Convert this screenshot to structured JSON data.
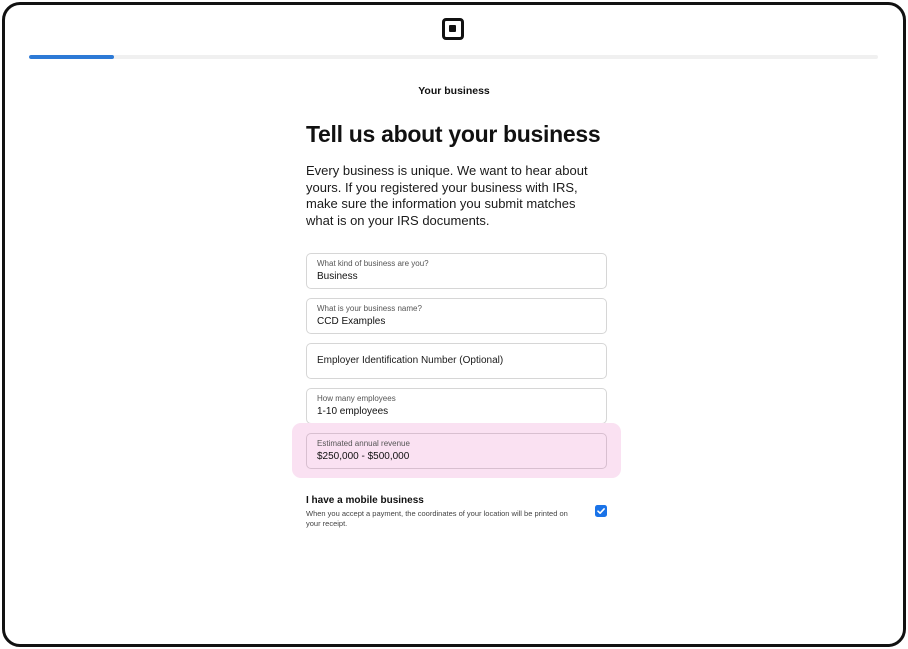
{
  "brand": {
    "logo_icon": "square-logo-icon"
  },
  "progress": {
    "fraction": 0.1
  },
  "step_label": "Your business",
  "page": {
    "title": "Tell us about your business",
    "intro": "Every business is unique. We want to hear about yours. If you registered your business with IRS, make sure the information you submit matches what is on your IRS documents."
  },
  "fields": {
    "business_type": {
      "label": "What kind of business are you?",
      "value": "Business"
    },
    "business_name": {
      "label": "What is your business name?",
      "value": "CCD Examples"
    },
    "ein": {
      "placeholder": "Employer Identification Number (Optional)"
    },
    "employees": {
      "label": "How many employees",
      "value": "1-10 employees"
    },
    "revenue": {
      "label": "Estimated annual revenue",
      "value": "$250,000 - $500,000"
    }
  },
  "mobile_business": {
    "title": "I have a mobile business",
    "description": "When you accept a payment, the coordinates of your location will be printed on your receipt.",
    "checked": true
  },
  "colors": {
    "accent": "#2d7ad6",
    "checkbox": "#1a73e8",
    "highlight": "#fae1f2"
  }
}
